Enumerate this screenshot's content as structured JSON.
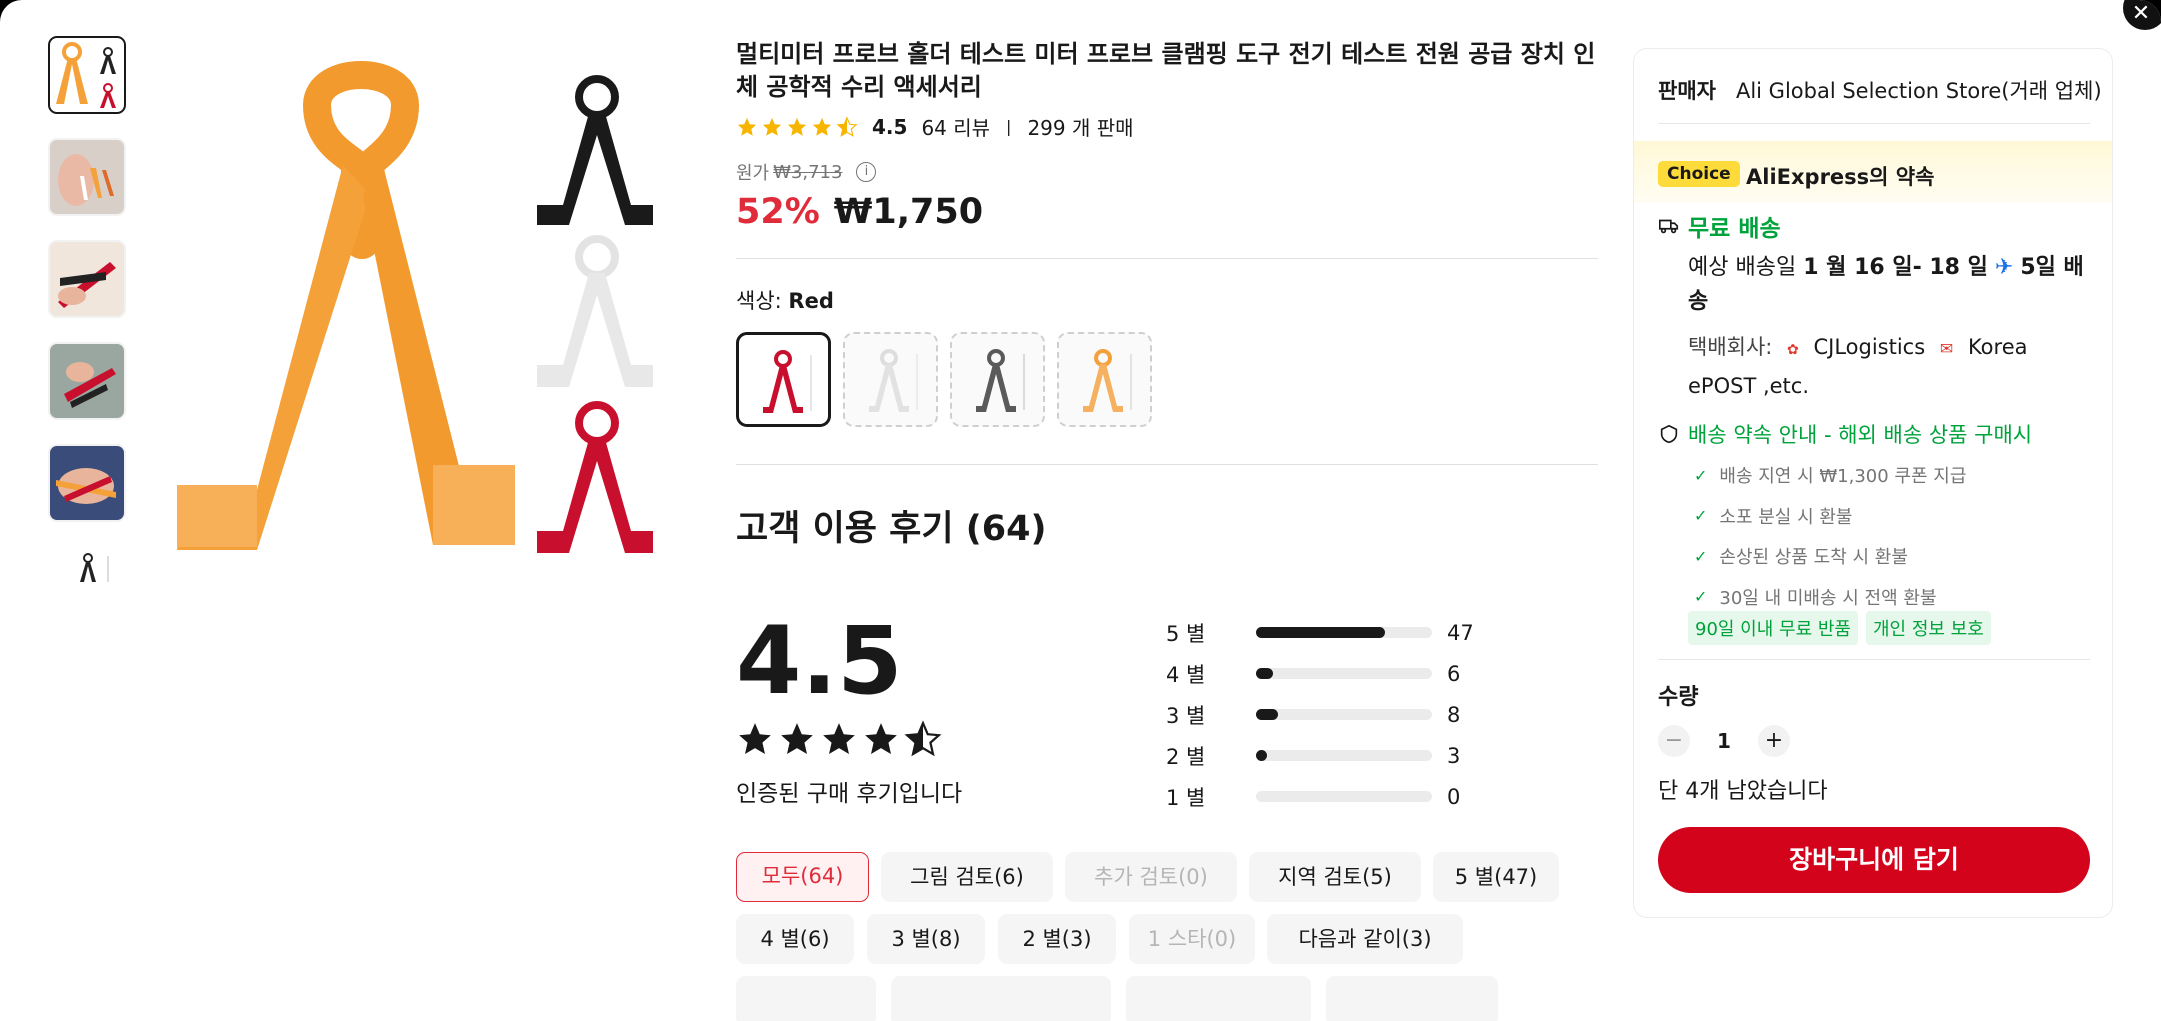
{
  "product": {
    "title": "멀티미터 프로브 홀더 테스트 미터 프로브 클램핑 도구 전기 테스트 전원 공급 장치 인체 공학적 수리 액세서리",
    "rating": "4.5",
    "reviews_label": "64 리뷰",
    "sold_label": "299 개 판매",
    "orig_label": "원가",
    "orig_price": "₩3,713",
    "discount": "52%",
    "price": "₩1,750",
    "color_label": "색상:",
    "color_value": "Red",
    "swatches": [
      {
        "name": "red",
        "color": "#c8102e"
      },
      {
        "name": "white",
        "color": "#e8e8e8"
      },
      {
        "name": "black",
        "color": "#5a5a5a"
      },
      {
        "name": "orange",
        "color": "#f5a13a"
      }
    ]
  },
  "reviews": {
    "title": "고객 이용 후기 (64)",
    "average": "4.5",
    "verified": "인증된 구매 후기입니다",
    "breakdown": [
      {
        "label": "5 별",
        "count": "47",
        "fraction": 0.734
      },
      {
        "label": "4 별",
        "count": "6",
        "fraction": 0.094
      },
      {
        "label": "3 별",
        "count": "8",
        "fraction": 0.125
      },
      {
        "label": "2 별",
        "count": "3",
        "fraction": 0.047
      },
      {
        "label": "1 별",
        "count": "0",
        "fraction": 0
      }
    ],
    "filters": [
      {
        "label": "모두(64)",
        "state": "active"
      },
      {
        "label": "그림 검토(6)",
        "state": "normal"
      },
      {
        "label": "추가 검토(0)",
        "state": "disabled"
      },
      {
        "label": "지역 검토(5)",
        "state": "normal"
      },
      {
        "label": "5 별(47)",
        "state": "normal"
      },
      {
        "label": "4 별(6)",
        "state": "normal"
      },
      {
        "label": "3 별(8)",
        "state": "normal"
      },
      {
        "label": "2 별(3)",
        "state": "normal"
      },
      {
        "label": "1 스타(0)",
        "state": "disabled"
      },
      {
        "label": "다음과 같이(3)",
        "state": "normal"
      }
    ]
  },
  "panel": {
    "seller_key": "판매자",
    "seller_name": "Ali Global Selection Store(거래 업체)",
    "choice": "Choice",
    "promise": "AliExpress의 약속",
    "free_shipping": "무료 배송",
    "delivery_prefix": "예상 배송일",
    "delivery_dates": "1 월 16 일- 18 일",
    "delivery_days": "5일 배송",
    "carrier_label": "택배회사:",
    "carrier_1": "CJLogistics",
    "carrier_2": "Korea ePOST ,etc.",
    "guarantee_head": "배송 약속 안내 - 해외 배송 상품 구매시",
    "guarantees": [
      "배송 지연 시 ₩1,300 쿠폰 지급",
      "소포 분실 시 환불",
      "손상된 상품 도착 시 환불",
      "30일 내 미배송 시 전액 환불"
    ],
    "tags": [
      "90일 이내 무료 반품",
      "개인 정보 보호"
    ],
    "qty_label": "수량",
    "qty_value": "1",
    "stock": "단 4개 남았습니다",
    "cart": "장바구니에 담기",
    "minus": "−",
    "plus": "+"
  },
  "colors": {
    "accent_red": "#e02c3a",
    "cart_red": "#d3031c",
    "green": "#00a33b",
    "star": "#f7b500",
    "choice_yellow": "#fddb3a"
  },
  "icons": {
    "close": "close-icon",
    "truck": "truck-icon",
    "shield": "shield-icon",
    "check": "check-icon",
    "info": "info-icon",
    "plane": "plane-icon"
  }
}
